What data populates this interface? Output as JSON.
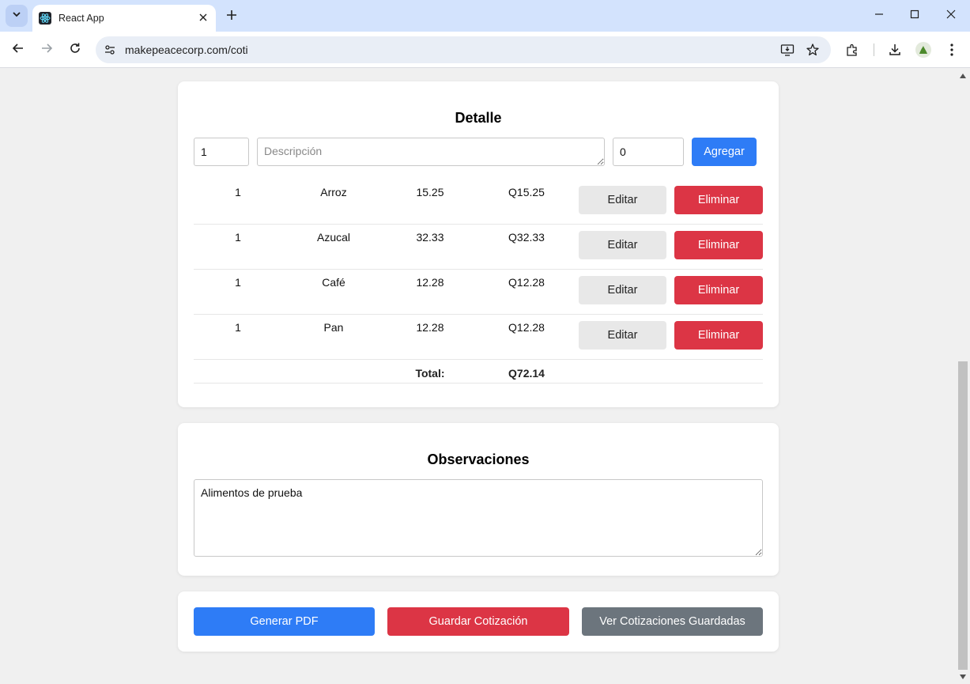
{
  "browser": {
    "tab_title": "React App",
    "url": "makepeacecorp.com/coti"
  },
  "detalle": {
    "title": "Detalle",
    "quantity_value": "1",
    "description_placeholder": "Descripción",
    "price_value": "0",
    "add_label": "Agregar",
    "edit_label": "Editar",
    "delete_label": "Eliminar",
    "items": [
      {
        "qty": "1",
        "desc": "Arroz",
        "price": "15.25",
        "subtotal": "Q15.25"
      },
      {
        "qty": "1",
        "desc": "Azucal",
        "price": "32.33",
        "subtotal": "Q32.33"
      },
      {
        "qty": "1",
        "desc": "Café",
        "price": "12.28",
        "subtotal": "Q12.28"
      },
      {
        "qty": "1",
        "desc": "Pan",
        "price": "12.28",
        "subtotal": "Q12.28"
      }
    ],
    "total_label": "Total:",
    "total_value": "Q72.14"
  },
  "observaciones": {
    "title": "Observaciones",
    "text": "Alimentos de prueba"
  },
  "actions": {
    "pdf_label": "Generar PDF",
    "save_label": "Guardar Cotización",
    "view_label": "Ver Cotizaciones Guardadas"
  },
  "colors": {
    "primary": "#2e7cf6",
    "danger": "#dc3545",
    "secondary": "#6c757d",
    "light": "#e8e8e8"
  }
}
